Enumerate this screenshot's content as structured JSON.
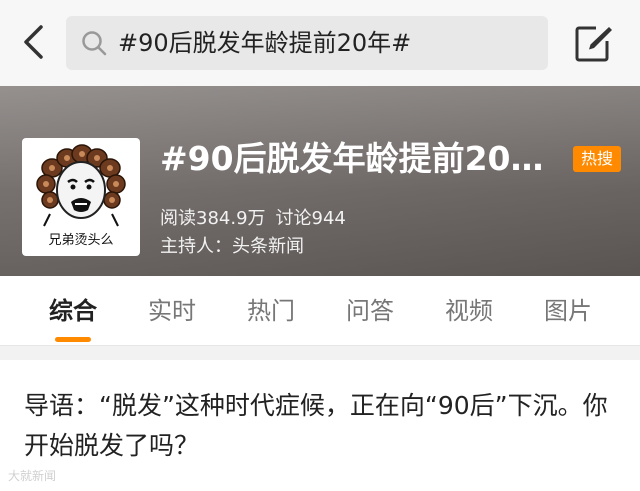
{
  "search": {
    "query": "#90后脱发年龄提前20年#"
  },
  "topic": {
    "title": "#90后脱发年龄提前20…",
    "badge": "热搜",
    "reads": "阅读384.9万",
    "discussions": "讨论944",
    "host": "主持人：头条新闻",
    "cover_caption": "兄弟烫头么"
  },
  "tabs": [
    {
      "label": "综合",
      "active": true
    },
    {
      "label": "实时"
    },
    {
      "label": "热门"
    },
    {
      "label": "问答"
    },
    {
      "label": "视频"
    },
    {
      "label": "图片"
    }
  ],
  "intro": {
    "text": "导语：“脱发”这种时代症候，正在向“90后”下沉。你开始脱发了吗？"
  },
  "watermark": "大就新闻",
  "colors": {
    "accent": "#ff8a00",
    "header_bg": "#7a7472"
  }
}
